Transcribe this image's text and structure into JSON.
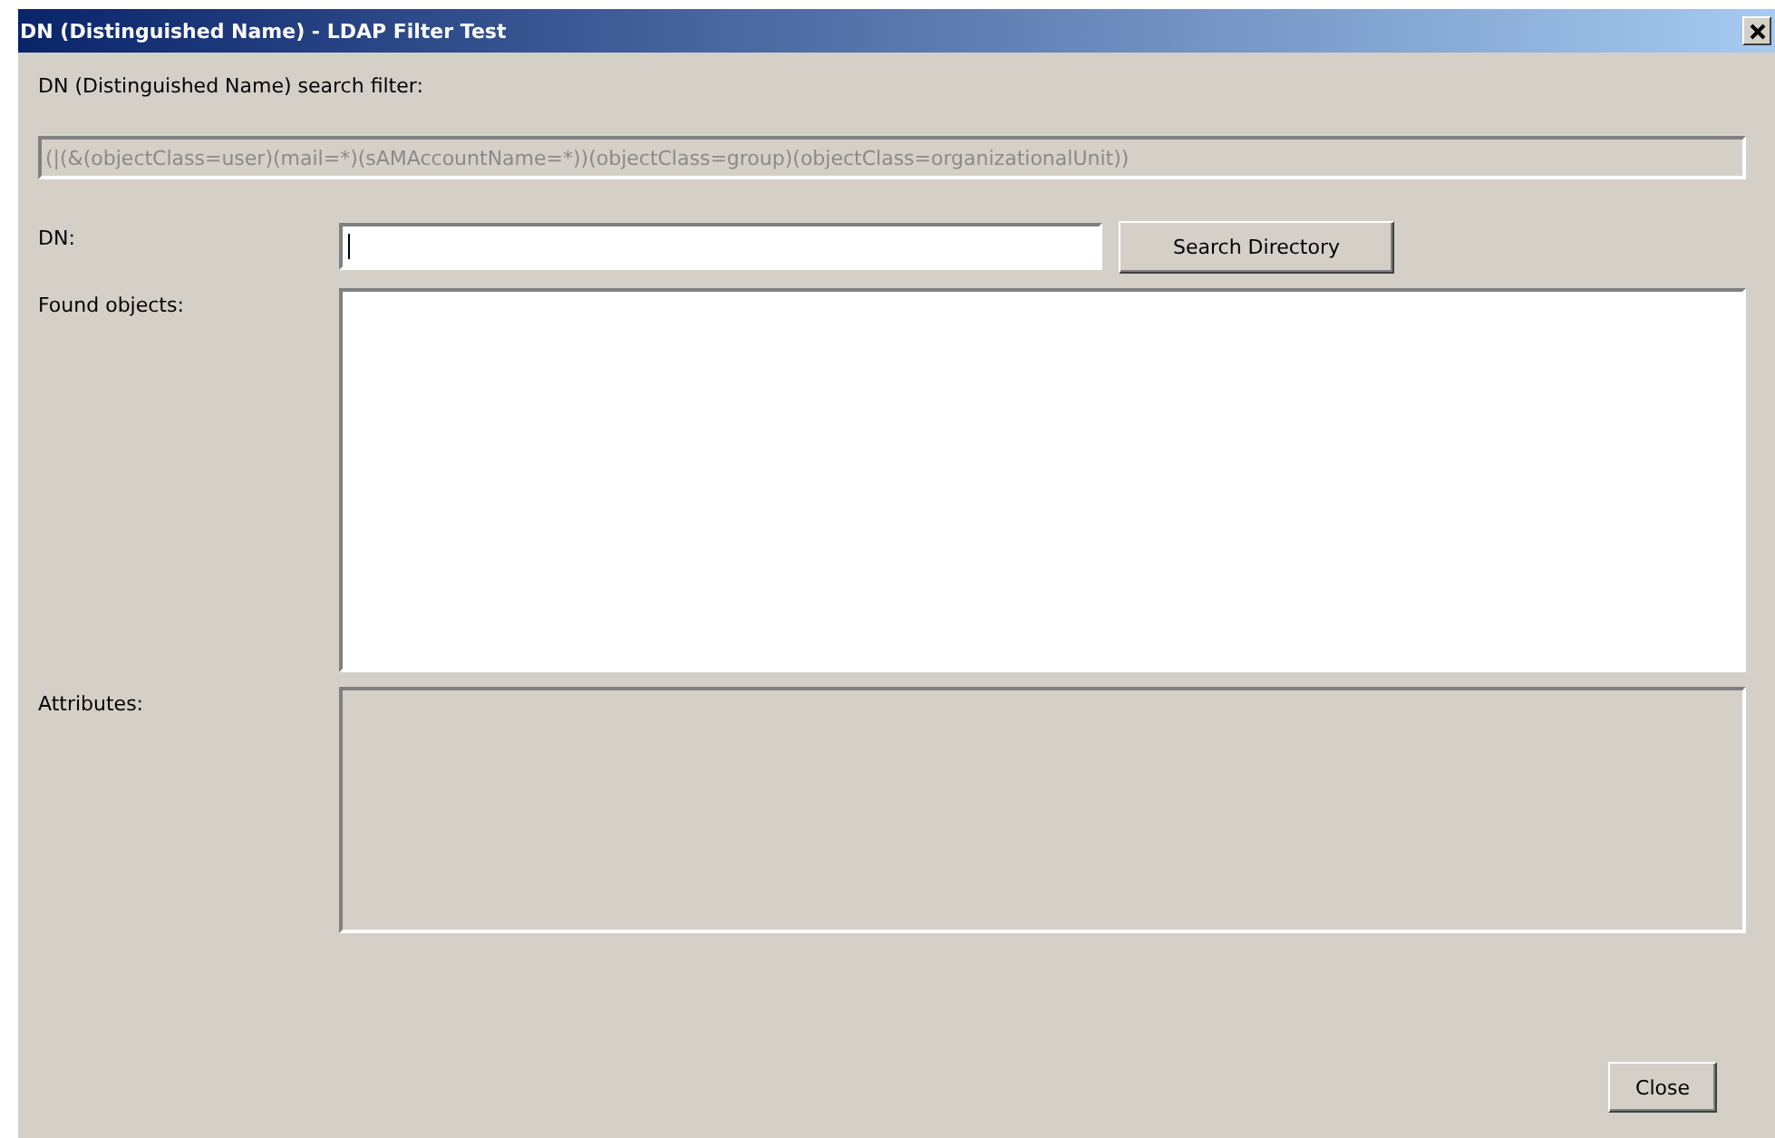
{
  "window": {
    "title": "DN (Distinguished Name)  - LDAP Filter Test"
  },
  "filter": {
    "label": "DN (Distinguished Name) search filter:",
    "value": "(|(&(objectClass=user)(mail=*)(sAMAccountName=*))(objectClass=group)(objectClass=organizationalUnit))",
    "disabled": true
  },
  "dn": {
    "label": "DN:",
    "focused": true
  },
  "search_button": "Search Directory",
  "found_objects": {
    "label": "Found objects:"
  },
  "attributes": {
    "label": "Attributes:",
    "disabled": true
  },
  "buttons": [
    "Close"
  ]
}
